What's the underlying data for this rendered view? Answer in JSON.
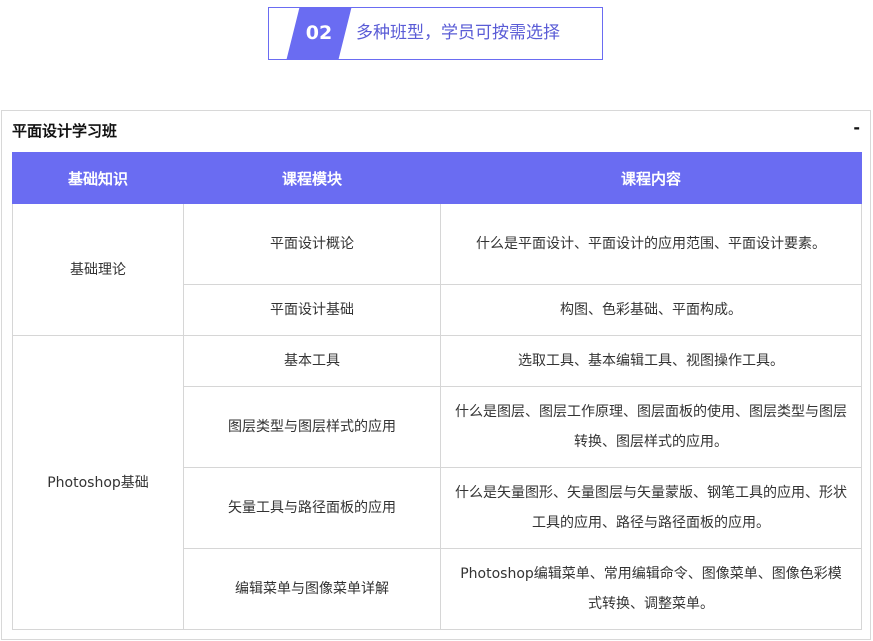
{
  "hero": {
    "number": "02",
    "text": "多种班型，学员可按需选择"
  },
  "panel": {
    "title": "平面设计学习班",
    "toggle": "-"
  },
  "table": {
    "headers": [
      "基础知识",
      "课程模块",
      "课程内容"
    ],
    "groups": [
      {
        "category": "基础理论",
        "rows": [
          {
            "module": "平面设计概论",
            "content": "什么是平面设计、平面设计的应用范围、平面设计要素。"
          },
          {
            "module": "平面设计基础",
            "content": "构图、色彩基础、平面构成。"
          }
        ]
      },
      {
        "category": "Photoshop基础",
        "rows": [
          {
            "module": "基本工具",
            "content": "选取工具、基本编辑工具、视图操作工具。"
          },
          {
            "module": "图层类型与图层样式的应用",
            "content": "什么是图层、图层工作原理、图层面板的使用、图层类型与图层转换、图层样式的应用。"
          },
          {
            "module": "矢量工具与路径面板的应用",
            "content": "什么是矢量图形、矢量图层与矢量蒙版、钢笔工具的应用、形状工具的应用、路径与路径面板的应用。"
          },
          {
            "module": "编辑菜单与图像菜单详解",
            "content": "Photoshop编辑菜单、常用编辑命令、图像菜单、图像色彩模式转换、调整菜单。"
          }
        ]
      }
    ]
  },
  "colors": {
    "accent": "#6a6cf2",
    "border": "#d6d6d6"
  }
}
